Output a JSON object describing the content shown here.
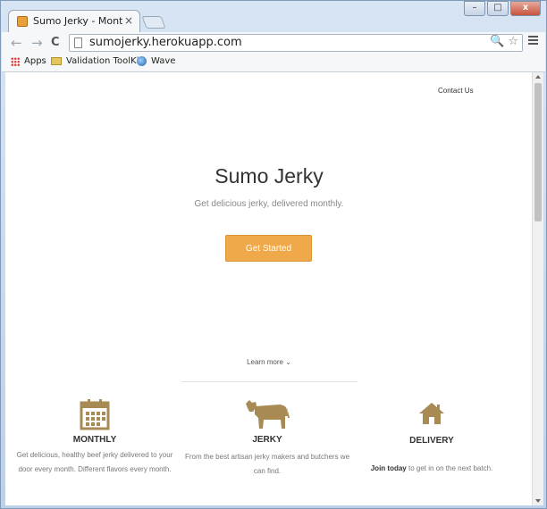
{
  "browser": {
    "tab_title": "Sumo Jerky - Monthly Jerk",
    "tab_close": "×",
    "url": "sumojerky.herokuapp.com",
    "back": "←",
    "forward": "→",
    "reload": "C",
    "omnibox_icons": "🔍 ☆",
    "bookmarks": [
      {
        "label": "Apps",
        "icon": "apps-grid-icon"
      },
      {
        "label": "Validation ToolKit",
        "icon": "folder-icon"
      },
      {
        "label": "Wave",
        "icon": "wave-icon"
      }
    ],
    "window_controls": {
      "minimize": "–",
      "maximize": "□",
      "close": "x"
    }
  },
  "page": {
    "nav": {
      "contact": "Contact Us"
    },
    "hero": {
      "title": "Sumo Jerky",
      "subtitle": "Get delicious jerky, delivered monthly.",
      "cta": "Get Started"
    },
    "learn_more": "Learn more ⌄",
    "features": [
      {
        "icon": "calendar-icon",
        "title": "MONTHLY",
        "text": "Get delicious, healthy beef jerky delivered to your door every month. Different flavors every month."
      },
      {
        "icon": "cow-icon",
        "title": "JERKY",
        "text": "From the best artisan jerky makers and butchers we can find."
      },
      {
        "icon": "house-icon",
        "title": "DELIVERY",
        "text_bold": "Join today",
        "text": " to get in on the next batch."
      }
    ],
    "accent_color": "#efa94a",
    "icon_color": "#a88a55"
  }
}
